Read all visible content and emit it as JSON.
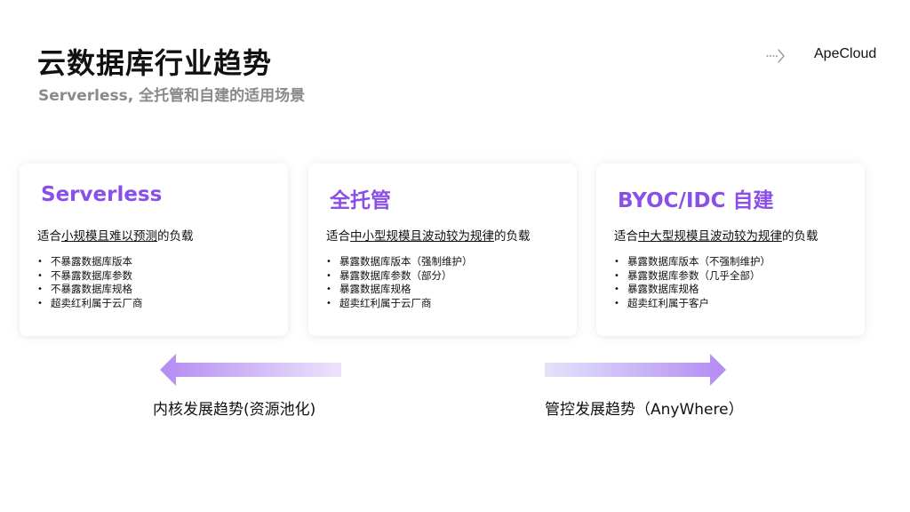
{
  "header": {
    "title": "云数据库行业趋势",
    "subtitle": "Serverless, 全托管和自建的适用场景"
  },
  "brand": {
    "name": "ApeCloud",
    "icon": "dotted-arrow-icon"
  },
  "colors": {
    "accent": "#8a4fe8",
    "arrow_light": "#ece4fb",
    "arrow_dark": "#b48bf2"
  },
  "cards": [
    {
      "title": "Serverless",
      "desc_prefix": "适合",
      "desc_highlight": "小规模且难以预测",
      "desc_suffix": "的负载",
      "items": [
        "不暴露数据库版本",
        "不暴露数据库参数",
        "不暴露数据库规格",
        "超卖红利属于云厂商"
      ]
    },
    {
      "title": "全托管",
      "desc_prefix": "适合",
      "desc_highlight": "中小型规模且波动较为规律",
      "desc_suffix": "的负载",
      "items": [
        "暴露数据库版本（强制维护）",
        "暴露数据库参数（部分）",
        "暴露数据库规格",
        "超卖红利属于云厂商"
      ]
    },
    {
      "title": "BYOC/IDC 自建",
      "desc_prefix": "适合",
      "desc_highlight": "中大型规模且波动较为规律",
      "desc_suffix": "的负载",
      "items": [
        "暴露数据库版本（不强制维护）",
        "暴露数据库参数（几乎全部）",
        "暴露数据库规格",
        "超卖红利属于客户"
      ]
    }
  ],
  "trends": {
    "left_label": "内核发展趋势(资源池化)",
    "right_label": "管控发展趋势（AnyWhere）"
  }
}
